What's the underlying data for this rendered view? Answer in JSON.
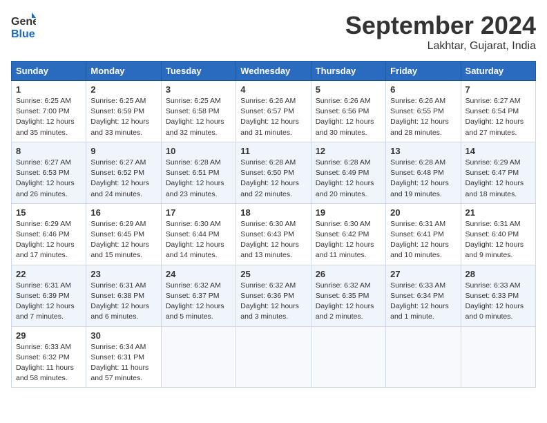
{
  "header": {
    "logo_general": "General",
    "logo_blue": "Blue",
    "month": "September 2024",
    "location": "Lakhtar, Gujarat, India"
  },
  "weekdays": [
    "Sunday",
    "Monday",
    "Tuesday",
    "Wednesday",
    "Thursday",
    "Friday",
    "Saturday"
  ],
  "weeks": [
    [
      {
        "day": "1",
        "sunrise": "6:25 AM",
        "sunset": "7:00 PM",
        "daylight": "12 hours and 35 minutes."
      },
      {
        "day": "2",
        "sunrise": "6:25 AM",
        "sunset": "6:59 PM",
        "daylight": "12 hours and 33 minutes."
      },
      {
        "day": "3",
        "sunrise": "6:25 AM",
        "sunset": "6:58 PM",
        "daylight": "12 hours and 32 minutes."
      },
      {
        "day": "4",
        "sunrise": "6:26 AM",
        "sunset": "6:57 PM",
        "daylight": "12 hours and 31 minutes."
      },
      {
        "day": "5",
        "sunrise": "6:26 AM",
        "sunset": "6:56 PM",
        "daylight": "12 hours and 30 minutes."
      },
      {
        "day": "6",
        "sunrise": "6:26 AM",
        "sunset": "6:55 PM",
        "daylight": "12 hours and 28 minutes."
      },
      {
        "day": "7",
        "sunrise": "6:27 AM",
        "sunset": "6:54 PM",
        "daylight": "12 hours and 27 minutes."
      }
    ],
    [
      {
        "day": "8",
        "sunrise": "6:27 AM",
        "sunset": "6:53 PM",
        "daylight": "12 hours and 26 minutes."
      },
      {
        "day": "9",
        "sunrise": "6:27 AM",
        "sunset": "6:52 PM",
        "daylight": "12 hours and 24 minutes."
      },
      {
        "day": "10",
        "sunrise": "6:28 AM",
        "sunset": "6:51 PM",
        "daylight": "12 hours and 23 minutes."
      },
      {
        "day": "11",
        "sunrise": "6:28 AM",
        "sunset": "6:50 PM",
        "daylight": "12 hours and 22 minutes."
      },
      {
        "day": "12",
        "sunrise": "6:28 AM",
        "sunset": "6:49 PM",
        "daylight": "12 hours and 20 minutes."
      },
      {
        "day": "13",
        "sunrise": "6:28 AM",
        "sunset": "6:48 PM",
        "daylight": "12 hours and 19 minutes."
      },
      {
        "day": "14",
        "sunrise": "6:29 AM",
        "sunset": "6:47 PM",
        "daylight": "12 hours and 18 minutes."
      }
    ],
    [
      {
        "day": "15",
        "sunrise": "6:29 AM",
        "sunset": "6:46 PM",
        "daylight": "12 hours and 17 minutes."
      },
      {
        "day": "16",
        "sunrise": "6:29 AM",
        "sunset": "6:45 PM",
        "daylight": "12 hours and 15 minutes."
      },
      {
        "day": "17",
        "sunrise": "6:30 AM",
        "sunset": "6:44 PM",
        "daylight": "12 hours and 14 minutes."
      },
      {
        "day": "18",
        "sunrise": "6:30 AM",
        "sunset": "6:43 PM",
        "daylight": "12 hours and 13 minutes."
      },
      {
        "day": "19",
        "sunrise": "6:30 AM",
        "sunset": "6:42 PM",
        "daylight": "12 hours and 11 minutes."
      },
      {
        "day": "20",
        "sunrise": "6:31 AM",
        "sunset": "6:41 PM",
        "daylight": "12 hours and 10 minutes."
      },
      {
        "day": "21",
        "sunrise": "6:31 AM",
        "sunset": "6:40 PM",
        "daylight": "12 hours and 9 minutes."
      }
    ],
    [
      {
        "day": "22",
        "sunrise": "6:31 AM",
        "sunset": "6:39 PM",
        "daylight": "12 hours and 7 minutes."
      },
      {
        "day": "23",
        "sunrise": "6:31 AM",
        "sunset": "6:38 PM",
        "daylight": "12 hours and 6 minutes."
      },
      {
        "day": "24",
        "sunrise": "6:32 AM",
        "sunset": "6:37 PM",
        "daylight": "12 hours and 5 minutes."
      },
      {
        "day": "25",
        "sunrise": "6:32 AM",
        "sunset": "6:36 PM",
        "daylight": "12 hours and 3 minutes."
      },
      {
        "day": "26",
        "sunrise": "6:32 AM",
        "sunset": "6:35 PM",
        "daylight": "12 hours and 2 minutes."
      },
      {
        "day": "27",
        "sunrise": "6:33 AM",
        "sunset": "6:34 PM",
        "daylight": "12 hours and 1 minute."
      },
      {
        "day": "28",
        "sunrise": "6:33 AM",
        "sunset": "6:33 PM",
        "daylight": "12 hours and 0 minutes."
      }
    ],
    [
      {
        "day": "29",
        "sunrise": "6:33 AM",
        "sunset": "6:32 PM",
        "daylight": "11 hours and 58 minutes."
      },
      {
        "day": "30",
        "sunrise": "6:34 AM",
        "sunset": "6:31 PM",
        "daylight": "11 hours and 57 minutes."
      },
      null,
      null,
      null,
      null,
      null
    ]
  ]
}
